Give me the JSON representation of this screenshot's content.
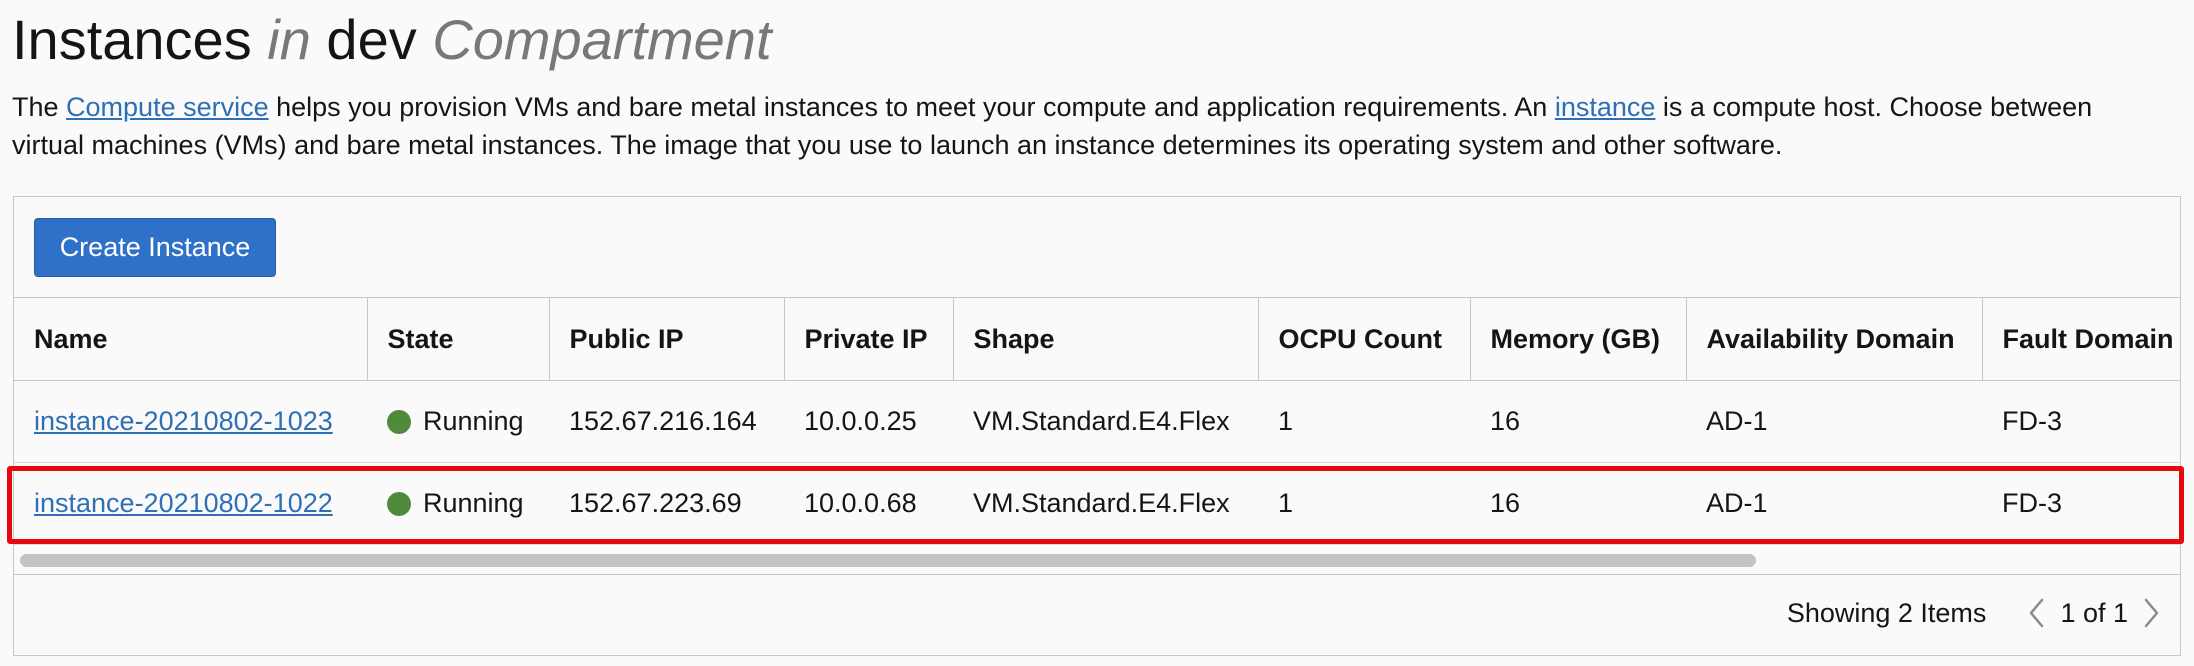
{
  "header": {
    "title_main": "Instances",
    "title_in": "in",
    "title_compartment": "dev",
    "title_suffix": "Compartment"
  },
  "description": {
    "part1": "The ",
    "link1": "Compute service",
    "part2": " helps you provision VMs and bare metal instances to meet your compute and application requirements. An ",
    "link2": "instance",
    "part3": " is a compute host. Choose between virtual machines (VMs) and bare metal instances. The image that you use to launch an instance determines its operating system and other software."
  },
  "toolbar": {
    "create_label": "Create Instance"
  },
  "table": {
    "columns": [
      "Name",
      "State",
      "Public IP",
      "Private IP",
      "Shape",
      "OCPU Count",
      "Memory (GB)",
      "Availability Domain",
      "Fault Domain"
    ],
    "rows": [
      {
        "name": "instance-20210802-1023",
        "state": "Running",
        "public_ip": "152.67.216.164",
        "private_ip": "10.0.0.25",
        "shape": "VM.Standard.E4.Flex",
        "ocpu": "1",
        "memory": "16",
        "ad": "AD-1",
        "fd": "FD-3"
      },
      {
        "name": "instance-20210802-1022",
        "state": "Running",
        "public_ip": "152.67.223.69",
        "private_ip": "10.0.0.68",
        "shape": "VM.Standard.E4.Flex",
        "ocpu": "1",
        "memory": "16",
        "ad": "AD-1",
        "fd": "FD-3"
      }
    ]
  },
  "pagination": {
    "showing": "Showing 2 Items",
    "page": "1 of 1"
  },
  "icons": {
    "status": "running-status-icon",
    "prev": "chevron-left-icon",
    "next": "chevron-right-icon"
  },
  "colors": {
    "link": "#2f6fb5",
    "primary_button": "#2f71c8",
    "running": "#4f8a3d",
    "highlight": "#e8090f"
  }
}
